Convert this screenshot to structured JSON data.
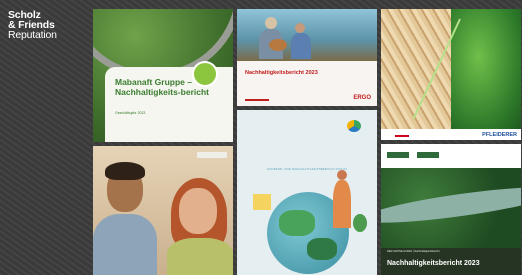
{
  "logo": {
    "line1": "Scholz",
    "line2": "& Friends",
    "line3": "Reputation"
  },
  "tiles": {
    "mabanaft": {
      "title": "Mabanaft Gruppe – Nachhaltigkeits-bericht",
      "subtitle": "Geschäftsjahr 2023"
    },
    "ergo": {
      "title": "Nachhaltigkeitsbericht 2023",
      "brand": "ERGO"
    },
    "konzern": {
      "heading": "KONZERN- UND NACHHALTIGKEITSBERICHT 2022/23"
    },
    "pfleiderer": {
      "brand": "PFLEIDERER"
    },
    "forest": {
      "caption": "DER GRÜNE HAFEN | Nachhaltigkeitsbericht",
      "title": "Nachhaltigkeitsbericht 2023"
    }
  },
  "colors": {
    "background": "#3b3b3b",
    "mabanaft_green": "#3a7d2f",
    "ergo_red": "#c01d1d",
    "pfleiderer_blue": "#1a4f9b"
  }
}
